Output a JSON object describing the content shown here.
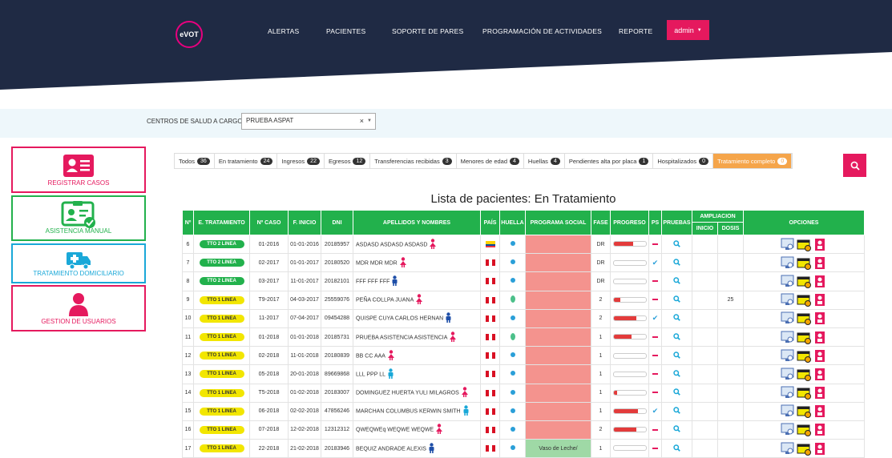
{
  "header": {
    "logo_text": "eVOT",
    "nav": [
      "ALERTAS",
      "PACIENTES",
      "SOPORTE DE PARES",
      "PROGRAMACIÓN DE ACTIVIDADES",
      "REPORTE"
    ],
    "admin_label": "admin"
  },
  "centers": {
    "label": "CENTROS DE SALUD A CARGO :",
    "value": "PRUEBA ASPAT"
  },
  "sidebar": [
    {
      "label": "REGISTRAR CASOS",
      "color": "#e5195e",
      "icon": "id-card-icon"
    },
    {
      "label": "ASISTENCIA MANUAL",
      "color": "#22b14c",
      "icon": "id-badge-check-icon"
    },
    {
      "label": "TRATAMIENTO DOMICILIARIO",
      "color": "#1aa8d8",
      "icon": "ambulance-icon"
    },
    {
      "label": "GESTION DE USUARIOS",
      "color": "#e5195e",
      "icon": "user-icon"
    }
  ],
  "filters": [
    {
      "label": "Todos",
      "count": "36"
    },
    {
      "label": "En tratamiento",
      "count": "24"
    },
    {
      "label": "Ingresos",
      "count": "22"
    },
    {
      "label": "Egresos",
      "count": "12"
    },
    {
      "label": "Transferencias recibidas",
      "count": "3"
    },
    {
      "label": "Menores de edad",
      "count": "4"
    },
    {
      "label": "Huellas",
      "count": "4"
    },
    {
      "label": "Pendientes alta por placa",
      "count": "1"
    },
    {
      "label": "Hospitalizados",
      "count": "0"
    },
    {
      "label": "Tratamiento completo",
      "count": "0"
    }
  ],
  "title": "Lista de pacientes: En Tratamiento",
  "table": {
    "headers": [
      "Nº",
      "E. TRATAMIENTO",
      "Nº CASO",
      "F. INICIO",
      "DNI",
      "APELLIDOS Y NOMBRES",
      "PAÍS",
      "HUELLA",
      "PROGRAMA SOCIAL",
      "FASE",
      "PROGRESO",
      "PS",
      "PRUEBAS",
      "AMPLIACION",
      "OPCIONES"
    ],
    "sub_headers": [
      "INICIO",
      "DOSIS"
    ],
    "rows": [
      {
        "n": "6",
        "status": "TTO 2 LINEA",
        "tone": "g",
        "caso": "01-2016",
        "inicio": "01-01-2016",
        "dni": "20185957",
        "name": "ASDASD ASDASD ASDASD",
        "gender": "f",
        "country": "ec",
        "print": "b",
        "social": "",
        "fase": "DR",
        "progress": 0.6,
        "ps": "dash",
        "amp_inicio": "",
        "amp_dosis": ""
      },
      {
        "n": "7",
        "status": "TTO 2 LINEA",
        "tone": "g",
        "caso": "02-2017",
        "inicio": "01-01-2017",
        "dni": "20180520",
        "name": "MDR MDR MDR",
        "gender": "f",
        "country": "pe",
        "print": "b",
        "social": "",
        "fase": "DR",
        "progress": 0,
        "ps": "check",
        "amp_inicio": "",
        "amp_dosis": ""
      },
      {
        "n": "8",
        "status": "TTO 2 LINEA",
        "tone": "g",
        "caso": "03-2017",
        "inicio": "11-01-2017",
        "dni": "20182101",
        "name": "FFF FFF FFF",
        "gender": "m",
        "country": "pe",
        "print": "b",
        "social": "",
        "fase": "DR",
        "progress": 0,
        "ps": "dash",
        "amp_inicio": "",
        "amp_dosis": ""
      },
      {
        "n": "9",
        "status": "TTO 1 LINEA",
        "tone": "y",
        "caso": "T9-2017",
        "inicio": "04-03-2017",
        "dni": "25559076",
        "name": "PEÑA COLLPA JUANA",
        "gender": "f",
        "country": "pe",
        "print": "g",
        "social": "",
        "fase": "2",
        "progress": 0.2,
        "ps": "dash",
        "amp_inicio": "",
        "amp_dosis": "25"
      },
      {
        "n": "10",
        "status": "TTO 1 LINEA",
        "tone": "y",
        "caso": "11-2017",
        "inicio": "07-04-2017",
        "dni": "09454288",
        "name": "QUISPE CUYA CARLOS HERNAN",
        "gender": "m",
        "country": "pe",
        "print": "b",
        "social": "",
        "fase": "2",
        "progress": 0.7,
        "ps": "check",
        "amp_inicio": "",
        "amp_dosis": ""
      },
      {
        "n": "11",
        "status": "TTO 1 LINEA",
        "tone": "y",
        "caso": "01-2018",
        "inicio": "01-01-2018",
        "dni": "20185731",
        "name": "PRUEBA ASISTENCIA ASISTENCIA",
        "gender": "f",
        "country": "pe",
        "print": "g",
        "social": "",
        "fase": "1",
        "progress": 0.55,
        "ps": "dash",
        "amp_inicio": "",
        "amp_dosis": ""
      },
      {
        "n": "12",
        "status": "TTO 1 LINEA",
        "tone": "y",
        "caso": "02-2018",
        "inicio": "11-01-2018",
        "dni": "20180839",
        "name": "BB CC AAA",
        "gender": "f",
        "country": "pe",
        "print": "b",
        "social": "",
        "fase": "1",
        "progress": 0,
        "ps": "dash",
        "amp_inicio": "",
        "amp_dosis": ""
      },
      {
        "n": "13",
        "status": "TTO 1 LINEA",
        "tone": "y",
        "caso": "05-2018",
        "inicio": "20-01-2018",
        "dni": "89669868",
        "name": "LLL PPP LL",
        "gender": "m2",
        "country": "pe",
        "print": "b",
        "social": "",
        "fase": "1",
        "progress": 0,
        "ps": "dash",
        "amp_inicio": "",
        "amp_dosis": ""
      },
      {
        "n": "14",
        "status": "TTO 1 LINEA",
        "tone": "y",
        "caso": "T5-2018",
        "inicio": "01-02-2018",
        "dni": "20183007",
        "name": "DOMINGUEZ HUERTA YULI MILAGROS",
        "gender": "f",
        "country": "pe",
        "print": "b",
        "social": "",
        "fase": "1",
        "progress": 0.1,
        "ps": "dash",
        "amp_inicio": "",
        "amp_dosis": ""
      },
      {
        "n": "15",
        "status": "TTO 1 LINEA",
        "tone": "y",
        "caso": "06-2018",
        "inicio": "02-02-2018",
        "dni": "47856246",
        "name": "MARCHAN COLUMBUS KERWIN SMITH",
        "gender": "m2",
        "country": "pe",
        "print": "b",
        "social": "",
        "fase": "1",
        "progress": 0.75,
        "ps": "check",
        "amp_inicio": "",
        "amp_dosis": ""
      },
      {
        "n": "16",
        "status": "TTO 1 LINEA",
        "tone": "y",
        "caso": "07-2018",
        "inicio": "12-02-2018",
        "dni": "12312312",
        "name": "QWEQWEq WEQWE WEQWE",
        "gender": "f",
        "country": "pe",
        "print": "b",
        "social": "",
        "fase": "2",
        "progress": 0.7,
        "ps": "dash",
        "amp_inicio": "",
        "amp_dosis": ""
      },
      {
        "n": "17",
        "status": "TTO 1 LINEA",
        "tone": "y",
        "caso": "22-2018",
        "inicio": "21-02-2018",
        "dni": "20183946",
        "name": "BEQUIZ ANDRADE ALEXIS",
        "gender": "m",
        "country": "pe",
        "print": "b",
        "social": "Vaso de Leche/",
        "fase": "1",
        "progress": 0,
        "ps": "dash",
        "amp_inicio": "",
        "amp_dosis": ""
      }
    ]
  }
}
